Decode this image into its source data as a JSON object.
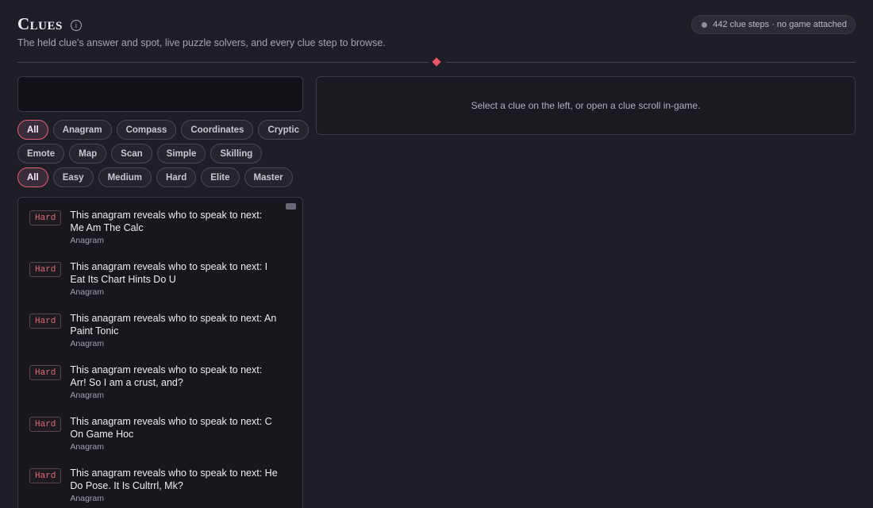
{
  "header": {
    "title": "Clues",
    "info_icon": "info-icon",
    "subtitle": "The held clue's answer and spot, live puzzle solvers, and every clue step to browse.",
    "status": "442 clue steps · no game attached"
  },
  "search": {
    "value": "",
    "placeholder": ""
  },
  "type_filters": [
    "All",
    "Anagram",
    "Compass",
    "Coordinates",
    "Cryptic",
    "Emote",
    "Map",
    "Scan",
    "Simple",
    "Skilling"
  ],
  "tier_filters": [
    "All",
    "Easy",
    "Medium",
    "Hard",
    "Elite",
    "Master"
  ],
  "detail": {
    "empty_message": "Select a clue on the left, or open a clue scroll in-game."
  },
  "clues": [
    {
      "tier": "Hard",
      "text": "This anagram reveals who to speak to next: Me Am The Calc",
      "type": "Anagram"
    },
    {
      "tier": "Hard",
      "text": "This anagram reveals who to speak to next: I Eat Its Chart Hints Do U",
      "type": "Anagram"
    },
    {
      "tier": "Hard",
      "text": "This anagram reveals who to speak to next: An Paint Tonic",
      "type": "Anagram"
    },
    {
      "tier": "Hard",
      "text": "This anagram reveals who to speak to next: Arr! So I am a crust, and?",
      "type": "Anagram"
    },
    {
      "tier": "Hard",
      "text": "This anagram reveals who to speak to next: C On Game Hoc",
      "type": "Anagram"
    },
    {
      "tier": "Hard",
      "text": "This anagram reveals who to speak to next: He Do Pose. It Is Cultrrl, Mk?",
      "type": "Anagram"
    }
  ],
  "colors": {
    "accent": "#e8566a",
    "tier_hard": "#e06b78",
    "background": "#1e1e26"
  }
}
